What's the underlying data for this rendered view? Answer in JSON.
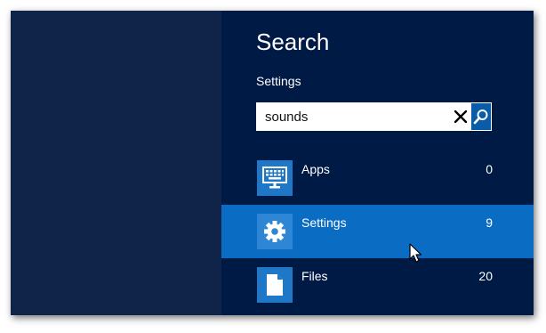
{
  "search": {
    "title": "Search",
    "scope": "Settings",
    "query": "sounds",
    "clear_icon": "close-icon",
    "go_icon": "magnifier-icon"
  },
  "results": [
    {
      "label": "Apps",
      "count": "0",
      "icon": "keyboard-monitor-icon",
      "selected": false
    },
    {
      "label": "Settings",
      "count": "9",
      "icon": "gear-icon",
      "selected": true
    },
    {
      "label": "Files",
      "count": "20",
      "icon": "document-icon",
      "selected": false
    }
  ],
  "colors": {
    "charm_bg": "#001a46",
    "left_bg": "#10244a",
    "selected_bg": "#0a6cc2",
    "tile_bg": "#1f77c8"
  }
}
